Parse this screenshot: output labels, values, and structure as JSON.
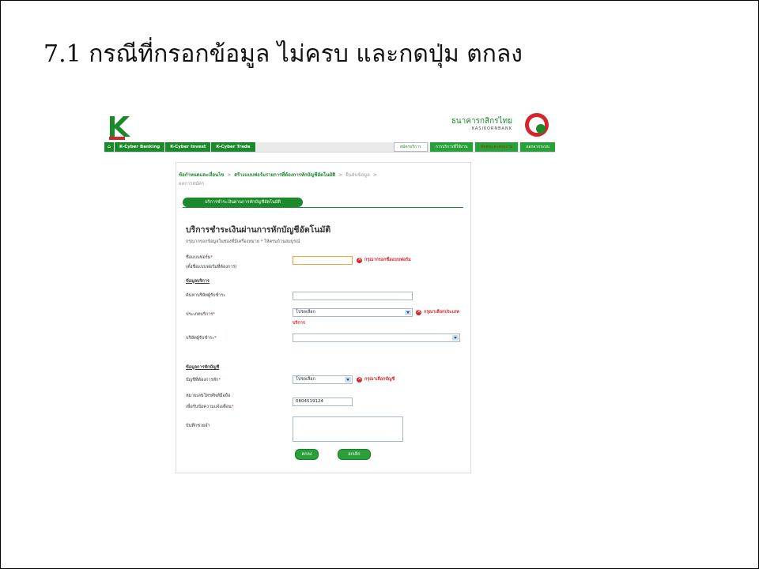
{
  "slide": {
    "title": "7.1 กรณีที่กรอกข้อมูล ไม่ครบ และกดปุ่ม ตกลง"
  },
  "header": {
    "bank_name": "ธนาคารกสิกรไทย",
    "bank_sub": "KASIKORNBANK",
    "logo_icon": "k-excellence-logo-icon",
    "emblem_icon": "kbank-emblem-icon"
  },
  "nav": {
    "home_icon": "home-icon",
    "items": [
      "K-Cyber Banking",
      "K-Cyber Invest",
      "K-Cyber Trade"
    ],
    "right_items": [
      "สมัครบริการ",
      "การบริการที่ใช้งาน",
      "ติดต่อและสอบถาม",
      "ออกจากระบบ"
    ]
  },
  "breadcrumb": {
    "step1": "ข้อกำหนดและเงื่อนไข",
    "step2": "สร้างแบบฟอร์มรายการที่ต้องการหักบัญชีอัตโนมัติ",
    "step3": "ยืนยันข้อมูล",
    "step4": "ผลการสมัคร",
    "separator": ">"
  },
  "form": {
    "pill_label": "บริการชำระเงินผ่านการหักบัญชีอัตโนมัติ",
    "title": "บริการชำระเงินผ่านการหักบัญชีอัตโนมัติ",
    "note": "กรุณากรอกข้อมูลในช่องที่มีเครื่องหมาย * ให้ครบถ้วนสมบูรณ์",
    "fields": {
      "form_name_label": "ชื่อแบบฟอร์ม",
      "form_name_sub": "(ตั้งชื่อแบบฟอร์มที่ต้องการ)",
      "form_name_value": "",
      "form_name_error": "กรุณากรอกชื่อแบบฟอร์ม",
      "service_section": "ข้อมูลบริการ",
      "search_label": "ค้นหาบริษัทผู้รับชำระ",
      "service_type_label": "ประเภทบริการ",
      "service_type_value": "โปรดเลือก",
      "service_type_error": "กรุณาเลือกประเภท",
      "service_type_error2": "บริการ",
      "company_label": "บริษัทผู้รับชำระ",
      "company_value": "",
      "account_section": "ข้อมูลการหักบัญชี",
      "account_label": "บัญชีที่ต้องการหัก",
      "account_value": "โปรดเลือก",
      "account_error": "กรุณาเลือกบัญชี",
      "mobile_label": "หมายเลขโทรศัพท์มือถือ",
      "mobile_label2": "เพื่อรับข้อความแจ้งเตือน",
      "mobile_value": "0804519124",
      "memo_label": "บันทึกช่วยจำ"
    },
    "buttons": {
      "ok": "ตกลง",
      "cancel": "ยกเลิก"
    }
  },
  "colors": {
    "brand_green": "#1a8a2a",
    "error_red": "#d4242c"
  }
}
